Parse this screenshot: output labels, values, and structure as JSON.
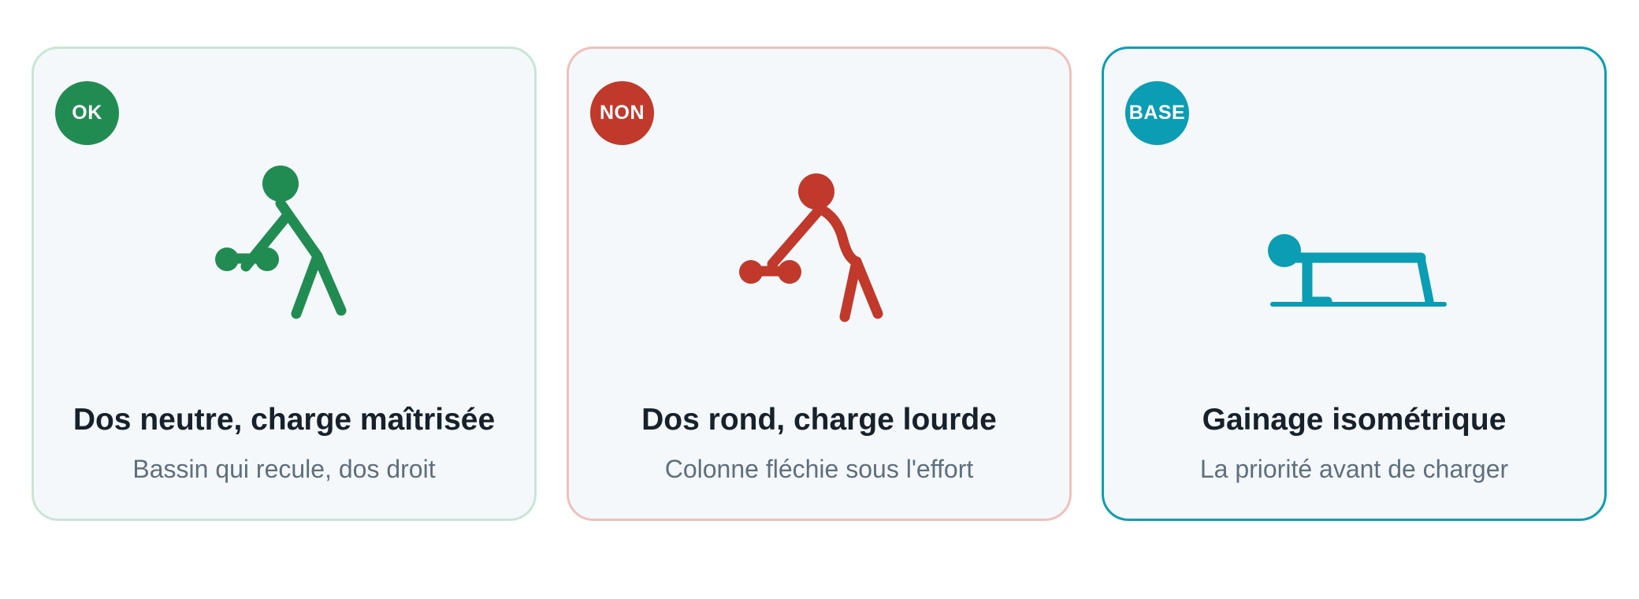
{
  "colors": {
    "ok": "#218c52",
    "no": "#c0392b",
    "base": "#0a9db4"
  },
  "cards": [
    {
      "badge": "OK",
      "title": "Dos neutre, charge maîtrisée",
      "subtitle": "Bassin qui recule, dos droit",
      "icon": "neutral-back-lift-figure"
    },
    {
      "badge": "NON",
      "title": "Dos rond, charge lourde",
      "subtitle": "Colonne fléchie sous l'effort",
      "icon": "rounded-back-lift-figure"
    },
    {
      "badge": "BASE",
      "title": "Gainage isométrique",
      "subtitle": "La priorité avant de charger",
      "icon": "plank-figure"
    }
  ]
}
